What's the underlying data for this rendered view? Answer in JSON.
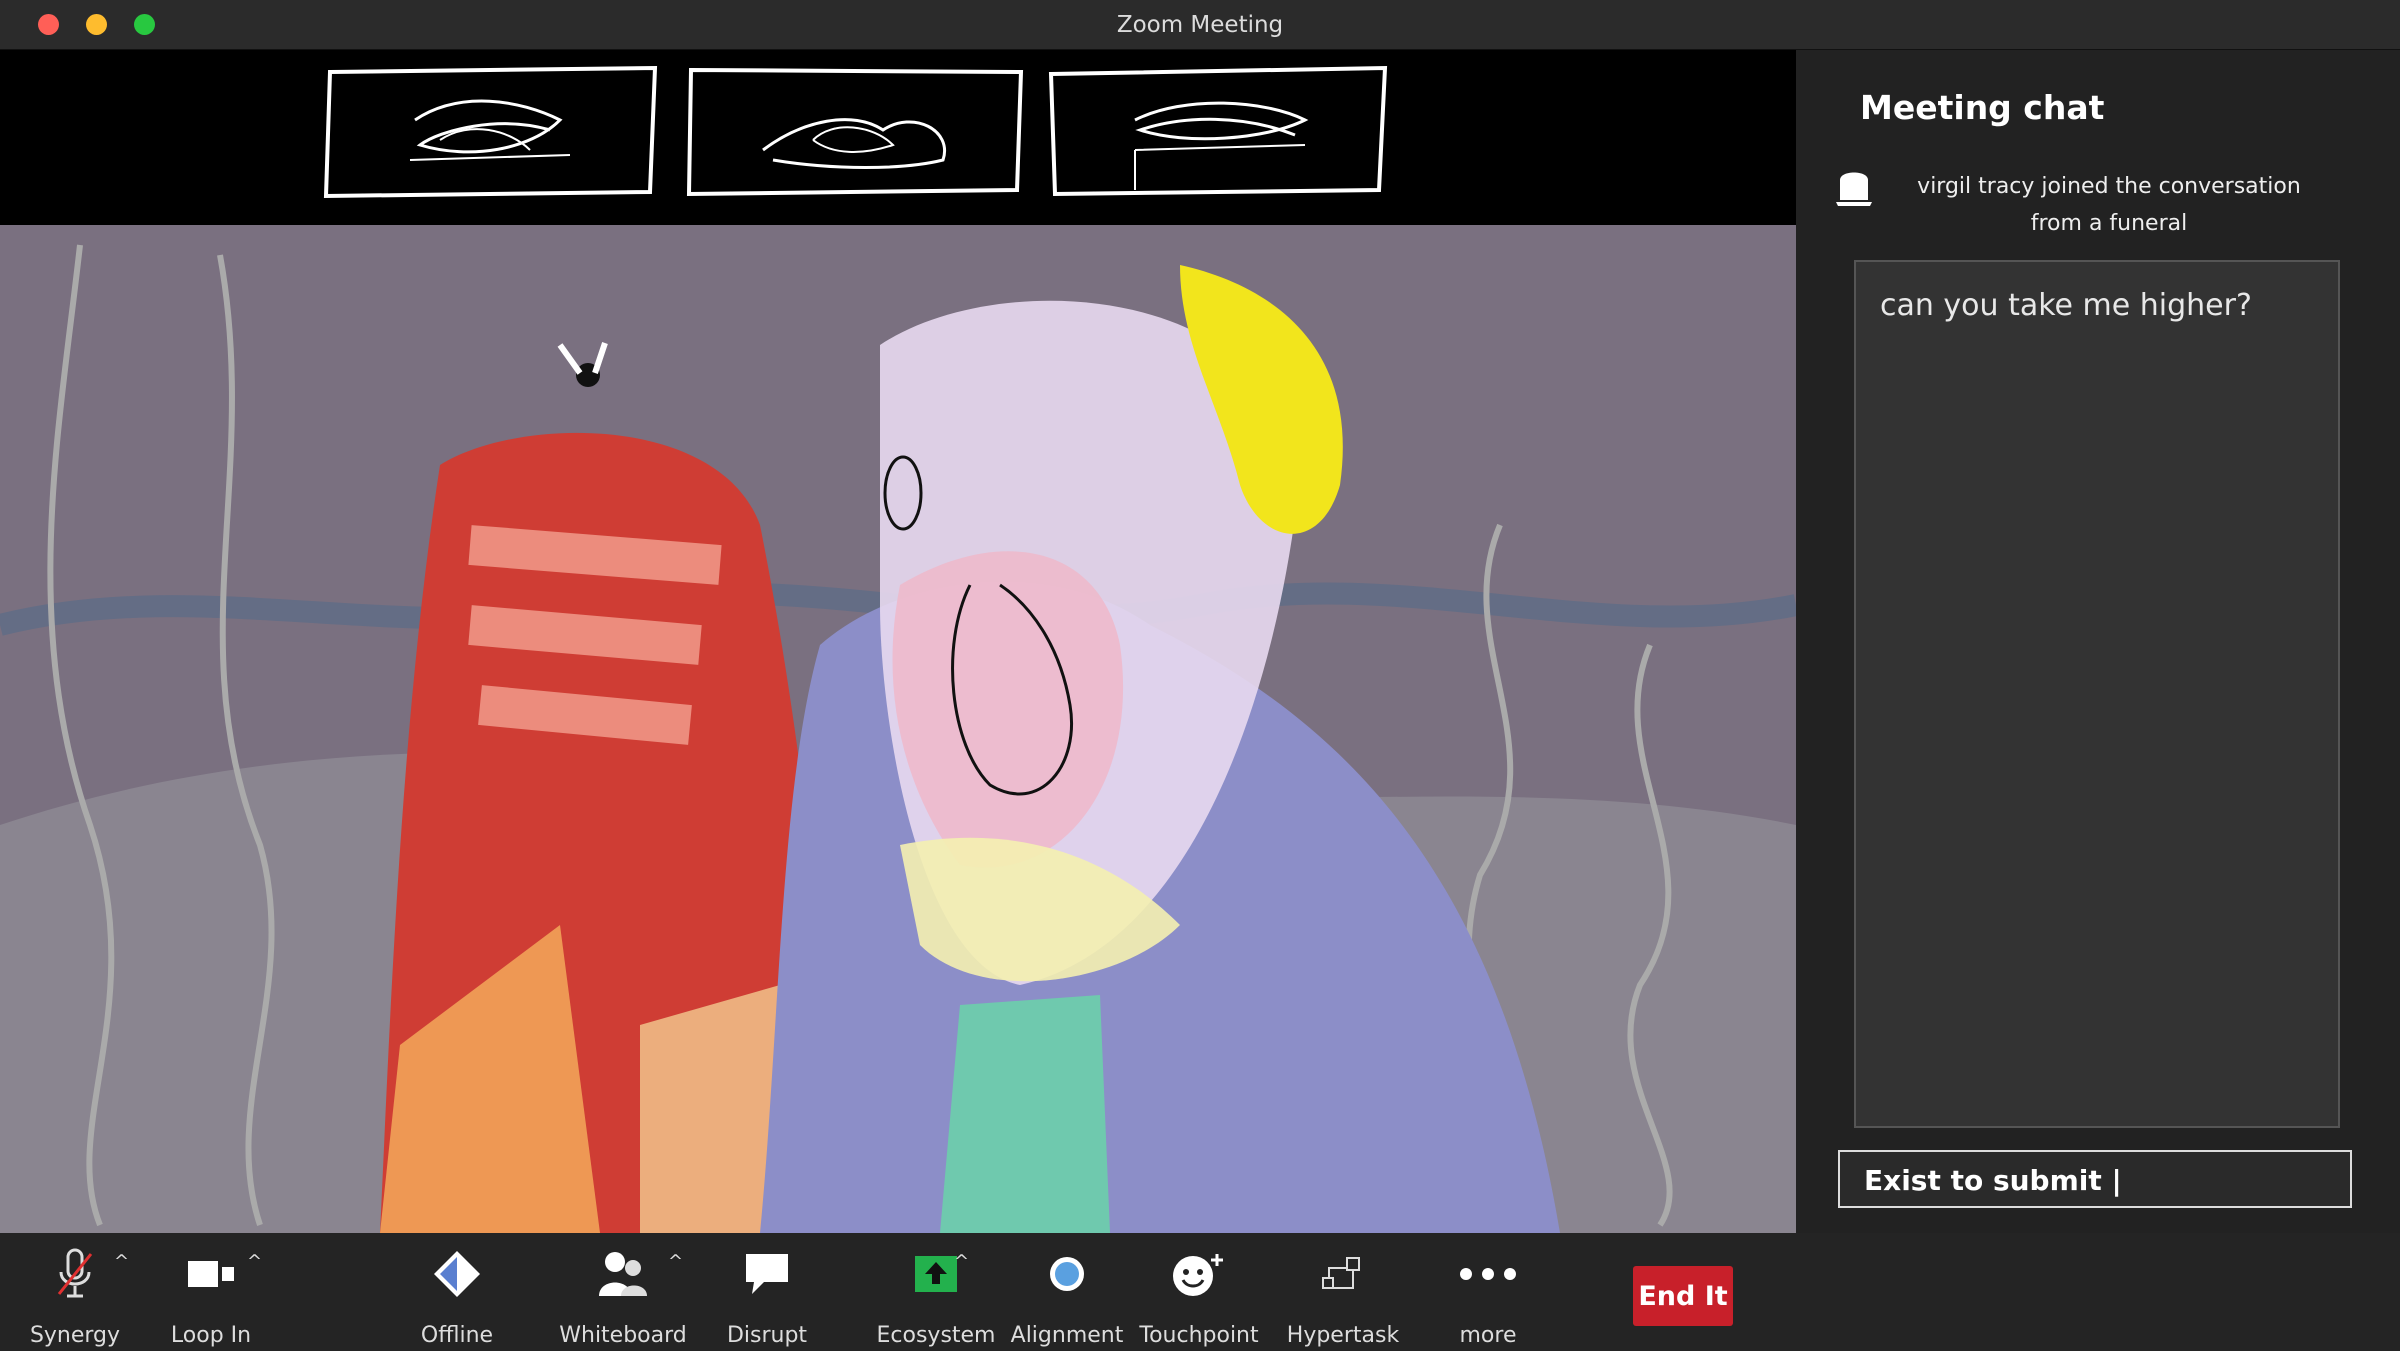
{
  "window": {
    "title": "Zoom Meeting"
  },
  "chat": {
    "title": "Meeting chat",
    "join_line1": "virgil tracy  joined the conversation",
    "join_line2": "from a funeral",
    "message": "can you take me higher?",
    "input_value": "Exist to submit |"
  },
  "toolbar": {
    "items": [
      {
        "label": "Synergy",
        "icon": "microphone-muted-icon"
      },
      {
        "label": "Loop In",
        "icon": "video-camera-icon"
      },
      {
        "label": "Offline",
        "icon": "diamond-logo-icon"
      },
      {
        "label": "Whiteboard",
        "icon": "participants-icon"
      },
      {
        "label": "Disrupt",
        "icon": "speech-bubble-icon"
      },
      {
        "label": "Ecosystem",
        "icon": "share-screen-icon"
      },
      {
        "label": "Alignment",
        "icon": "record-icon"
      },
      {
        "label": "Touchpoint",
        "icon": "smiley-icon"
      },
      {
        "label": "Hypertask",
        "icon": "breakout-icon"
      },
      {
        "label": "more",
        "icon": "more-dots-icon"
      }
    ],
    "end_label": "End It"
  },
  "colors": {
    "end_button": "#c8202a",
    "share_green": "#23b14d",
    "panel": "#222222",
    "toolbar": "#242424"
  }
}
